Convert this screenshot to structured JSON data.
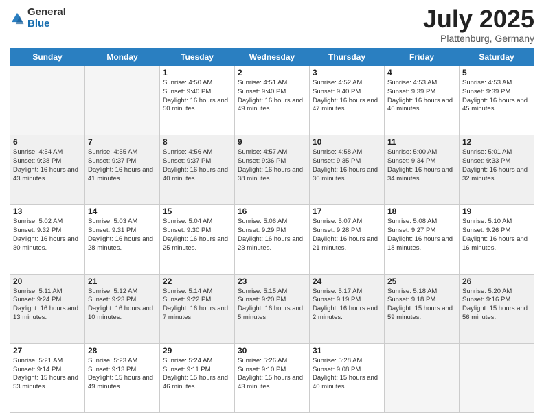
{
  "header": {
    "logo_general": "General",
    "logo_blue": "Blue",
    "month_title": "July 2025",
    "location": "Plattenburg, Germany"
  },
  "days_of_week": [
    "Sunday",
    "Monday",
    "Tuesday",
    "Wednesday",
    "Thursday",
    "Friday",
    "Saturday"
  ],
  "weeks": [
    [
      {
        "day": "",
        "info": ""
      },
      {
        "day": "",
        "info": ""
      },
      {
        "day": "1",
        "info": "Sunrise: 4:50 AM\nSunset: 9:40 PM\nDaylight: 16 hours and 50 minutes."
      },
      {
        "day": "2",
        "info": "Sunrise: 4:51 AM\nSunset: 9:40 PM\nDaylight: 16 hours and 49 minutes."
      },
      {
        "day": "3",
        "info": "Sunrise: 4:52 AM\nSunset: 9:40 PM\nDaylight: 16 hours and 47 minutes."
      },
      {
        "day": "4",
        "info": "Sunrise: 4:53 AM\nSunset: 9:39 PM\nDaylight: 16 hours and 46 minutes."
      },
      {
        "day": "5",
        "info": "Sunrise: 4:53 AM\nSunset: 9:39 PM\nDaylight: 16 hours and 45 minutes."
      }
    ],
    [
      {
        "day": "6",
        "info": "Sunrise: 4:54 AM\nSunset: 9:38 PM\nDaylight: 16 hours and 43 minutes."
      },
      {
        "day": "7",
        "info": "Sunrise: 4:55 AM\nSunset: 9:37 PM\nDaylight: 16 hours and 41 minutes."
      },
      {
        "day": "8",
        "info": "Sunrise: 4:56 AM\nSunset: 9:37 PM\nDaylight: 16 hours and 40 minutes."
      },
      {
        "day": "9",
        "info": "Sunrise: 4:57 AM\nSunset: 9:36 PM\nDaylight: 16 hours and 38 minutes."
      },
      {
        "day": "10",
        "info": "Sunrise: 4:58 AM\nSunset: 9:35 PM\nDaylight: 16 hours and 36 minutes."
      },
      {
        "day": "11",
        "info": "Sunrise: 5:00 AM\nSunset: 9:34 PM\nDaylight: 16 hours and 34 minutes."
      },
      {
        "day": "12",
        "info": "Sunrise: 5:01 AM\nSunset: 9:33 PM\nDaylight: 16 hours and 32 minutes."
      }
    ],
    [
      {
        "day": "13",
        "info": "Sunrise: 5:02 AM\nSunset: 9:32 PM\nDaylight: 16 hours and 30 minutes."
      },
      {
        "day": "14",
        "info": "Sunrise: 5:03 AM\nSunset: 9:31 PM\nDaylight: 16 hours and 28 minutes."
      },
      {
        "day": "15",
        "info": "Sunrise: 5:04 AM\nSunset: 9:30 PM\nDaylight: 16 hours and 25 minutes."
      },
      {
        "day": "16",
        "info": "Sunrise: 5:06 AM\nSunset: 9:29 PM\nDaylight: 16 hours and 23 minutes."
      },
      {
        "day": "17",
        "info": "Sunrise: 5:07 AM\nSunset: 9:28 PM\nDaylight: 16 hours and 21 minutes."
      },
      {
        "day": "18",
        "info": "Sunrise: 5:08 AM\nSunset: 9:27 PM\nDaylight: 16 hours and 18 minutes."
      },
      {
        "day": "19",
        "info": "Sunrise: 5:10 AM\nSunset: 9:26 PM\nDaylight: 16 hours and 16 minutes."
      }
    ],
    [
      {
        "day": "20",
        "info": "Sunrise: 5:11 AM\nSunset: 9:24 PM\nDaylight: 16 hours and 13 minutes."
      },
      {
        "day": "21",
        "info": "Sunrise: 5:12 AM\nSunset: 9:23 PM\nDaylight: 16 hours and 10 minutes."
      },
      {
        "day": "22",
        "info": "Sunrise: 5:14 AM\nSunset: 9:22 PM\nDaylight: 16 hours and 7 minutes."
      },
      {
        "day": "23",
        "info": "Sunrise: 5:15 AM\nSunset: 9:20 PM\nDaylight: 16 hours and 5 minutes."
      },
      {
        "day": "24",
        "info": "Sunrise: 5:17 AM\nSunset: 9:19 PM\nDaylight: 16 hours and 2 minutes."
      },
      {
        "day": "25",
        "info": "Sunrise: 5:18 AM\nSunset: 9:18 PM\nDaylight: 15 hours and 59 minutes."
      },
      {
        "day": "26",
        "info": "Sunrise: 5:20 AM\nSunset: 9:16 PM\nDaylight: 15 hours and 56 minutes."
      }
    ],
    [
      {
        "day": "27",
        "info": "Sunrise: 5:21 AM\nSunset: 9:14 PM\nDaylight: 15 hours and 53 minutes."
      },
      {
        "day": "28",
        "info": "Sunrise: 5:23 AM\nSunset: 9:13 PM\nDaylight: 15 hours and 49 minutes."
      },
      {
        "day": "29",
        "info": "Sunrise: 5:24 AM\nSunset: 9:11 PM\nDaylight: 15 hours and 46 minutes."
      },
      {
        "day": "30",
        "info": "Sunrise: 5:26 AM\nSunset: 9:10 PM\nDaylight: 15 hours and 43 minutes."
      },
      {
        "day": "31",
        "info": "Sunrise: 5:28 AM\nSunset: 9:08 PM\nDaylight: 15 hours and 40 minutes."
      },
      {
        "day": "",
        "info": ""
      },
      {
        "day": "",
        "info": ""
      }
    ]
  ]
}
